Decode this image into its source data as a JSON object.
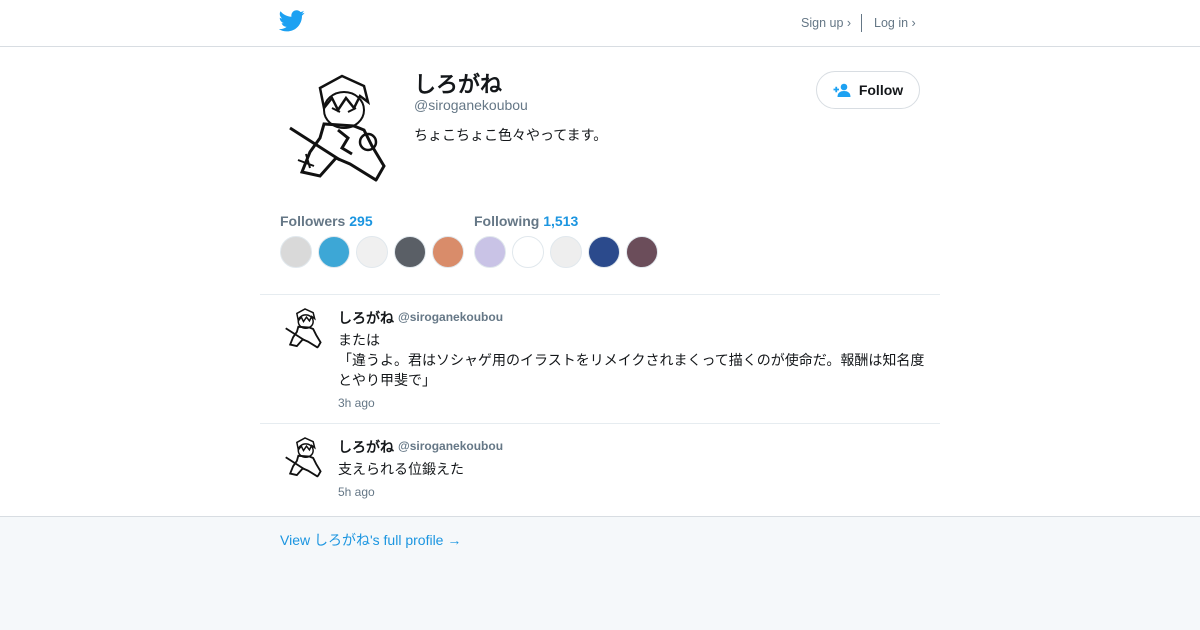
{
  "header": {
    "logo_icon": "twitter-bird-icon",
    "signup_label": "Sign up ›",
    "login_label": "Log in ›"
  },
  "profile": {
    "name": "しろがね",
    "handle": "@siroganekoubou",
    "bio": "ちょこちょこ色々やってます。",
    "follow_label": "Follow",
    "followers_label": "Followers",
    "followers_count": "295",
    "following_label": "Following",
    "following_count": "1,513"
  },
  "followers_avatars": [
    {
      "name": "follower-1",
      "color": "#d9d9d9"
    },
    {
      "name": "follower-2",
      "color": "#3da7d6"
    },
    {
      "name": "follower-3",
      "color": "#f0f0f0"
    },
    {
      "name": "follower-4",
      "color": "#5a5f66"
    },
    {
      "name": "follower-5",
      "color": "#d98c6a"
    }
  ],
  "following_avatars": [
    {
      "name": "following-1",
      "color": "#c9c3e6"
    },
    {
      "name": "following-2",
      "color": "#ffffff"
    },
    {
      "name": "following-3",
      "color": "#eeeeee"
    },
    {
      "name": "following-4",
      "color": "#2b4a8c"
    },
    {
      "name": "following-5",
      "color": "#6b4d5a"
    }
  ],
  "tweets": [
    {
      "name": "しろがね",
      "handle": "@siroganekoubou",
      "lines": [
        "または",
        "「違うよ。君はソシャゲ用のイラストをリメイクされまくって描くのが使命だ。報酬は知名度",
        "とやり甲斐で」"
      ],
      "time": "3h ago"
    },
    {
      "name": "しろがね",
      "handle": "@siroganekoubou",
      "lines": [
        "支えられる位鍛えた"
      ],
      "time": "5h ago"
    }
  ],
  "footer": {
    "full_profile_link": "View しろがね's full profile →"
  },
  "colors": {
    "accent": "#1b95e0",
    "bird": "#1da1f2",
    "muted": "#657786"
  }
}
